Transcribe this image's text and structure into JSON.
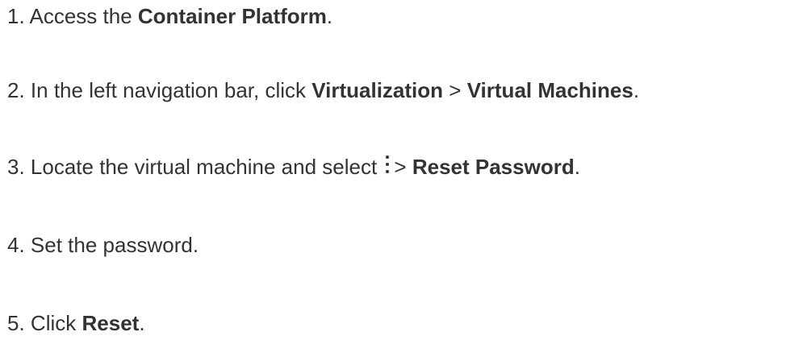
{
  "steps": [
    {
      "number": "1.",
      "text_before": "Access the",
      "bold_1": "Container Platform",
      "text_after": "."
    },
    {
      "number": "2.",
      "text_before": "In the left navigation bar, click",
      "bold_1": "Virtualization",
      "separator": ">",
      "bold_2": "Virtual Machines",
      "text_after": "."
    },
    {
      "number": "3.",
      "text_before": "Locate the virtual machine and select",
      "icon": "kebab-icon",
      "separator": ">",
      "bold_1": "Reset Password",
      "text_after": "."
    },
    {
      "number": "4.",
      "text_before": "Set the password."
    },
    {
      "number": "5.",
      "text_before": "Click",
      "bold_1": "Reset",
      "text_after": "."
    }
  ]
}
